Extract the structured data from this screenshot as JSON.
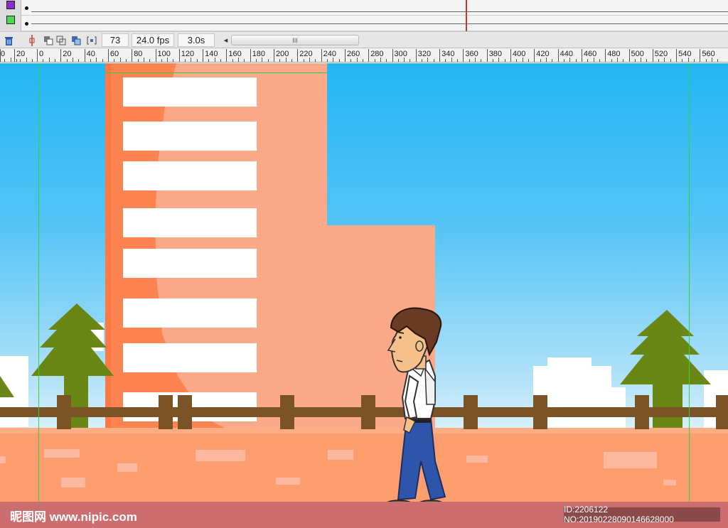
{
  "timeline": {
    "layers": [
      {
        "color": "#8b2fc9",
        "icon": "layer-color-swatch-icon"
      },
      {
        "color": "#4fd84f",
        "icon": "layer-color-swatch-icon"
      }
    ],
    "current_frame": "73",
    "frame_rate": "24.0 fps",
    "elapsed_time": "3.0s",
    "scroll_grip": "III",
    "scroll_left_arrow": "◂"
  },
  "ruler": {
    "labels": [
      "0",
      "20",
      "0",
      "20",
      "40",
      "60",
      "80",
      "100",
      "120",
      "140",
      "160",
      "180",
      "200",
      "220",
      "240",
      "260",
      "280",
      "300",
      "320",
      "340",
      "360",
      "380",
      "400",
      "420",
      "440",
      "460",
      "480",
      "500",
      "520",
      "540",
      "560"
    ]
  },
  "stage": {
    "colors": {
      "sky_top": "#23b6f3",
      "building": "#fca98a",
      "building_shadow": "#fd8450",
      "ground": "#fe9e6f",
      "fence": "#7a5327",
      "tree": "#6a8716",
      "shirt": "#ffffff",
      "pants": "#2e55aa",
      "hair": "#6b3a22"
    },
    "character": "man-walking"
  },
  "watermark": {
    "site": "昵图网 www.nipic.com",
    "id_text": "ID:2206122 NO:20190228090146628000"
  }
}
